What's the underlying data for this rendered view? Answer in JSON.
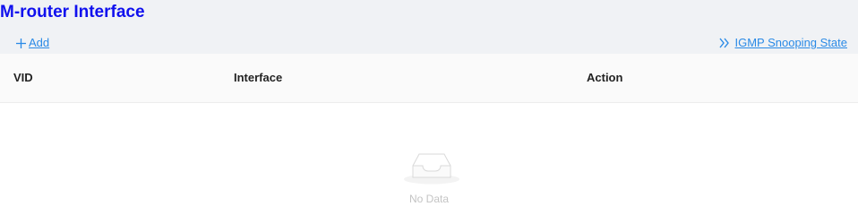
{
  "header": {
    "title": "M-router Interface"
  },
  "toolbar": {
    "add_label": "Add",
    "add_icon": "plus-icon",
    "state_link_label": "IGMP Snooping State",
    "state_link_icon": "double-chevron-right-icon"
  },
  "table": {
    "columns": [
      "VID",
      "Interface",
      "Action"
    ],
    "rows": [],
    "empty_icon": "empty-inbox-icon",
    "empty_text": "No Data"
  },
  "colors": {
    "title": "#1010ee",
    "link": "#2a8ae6",
    "header_band": "#f0f2f5",
    "table_header_bg": "#fafafa",
    "empty_text": "#c4c4c4"
  }
}
